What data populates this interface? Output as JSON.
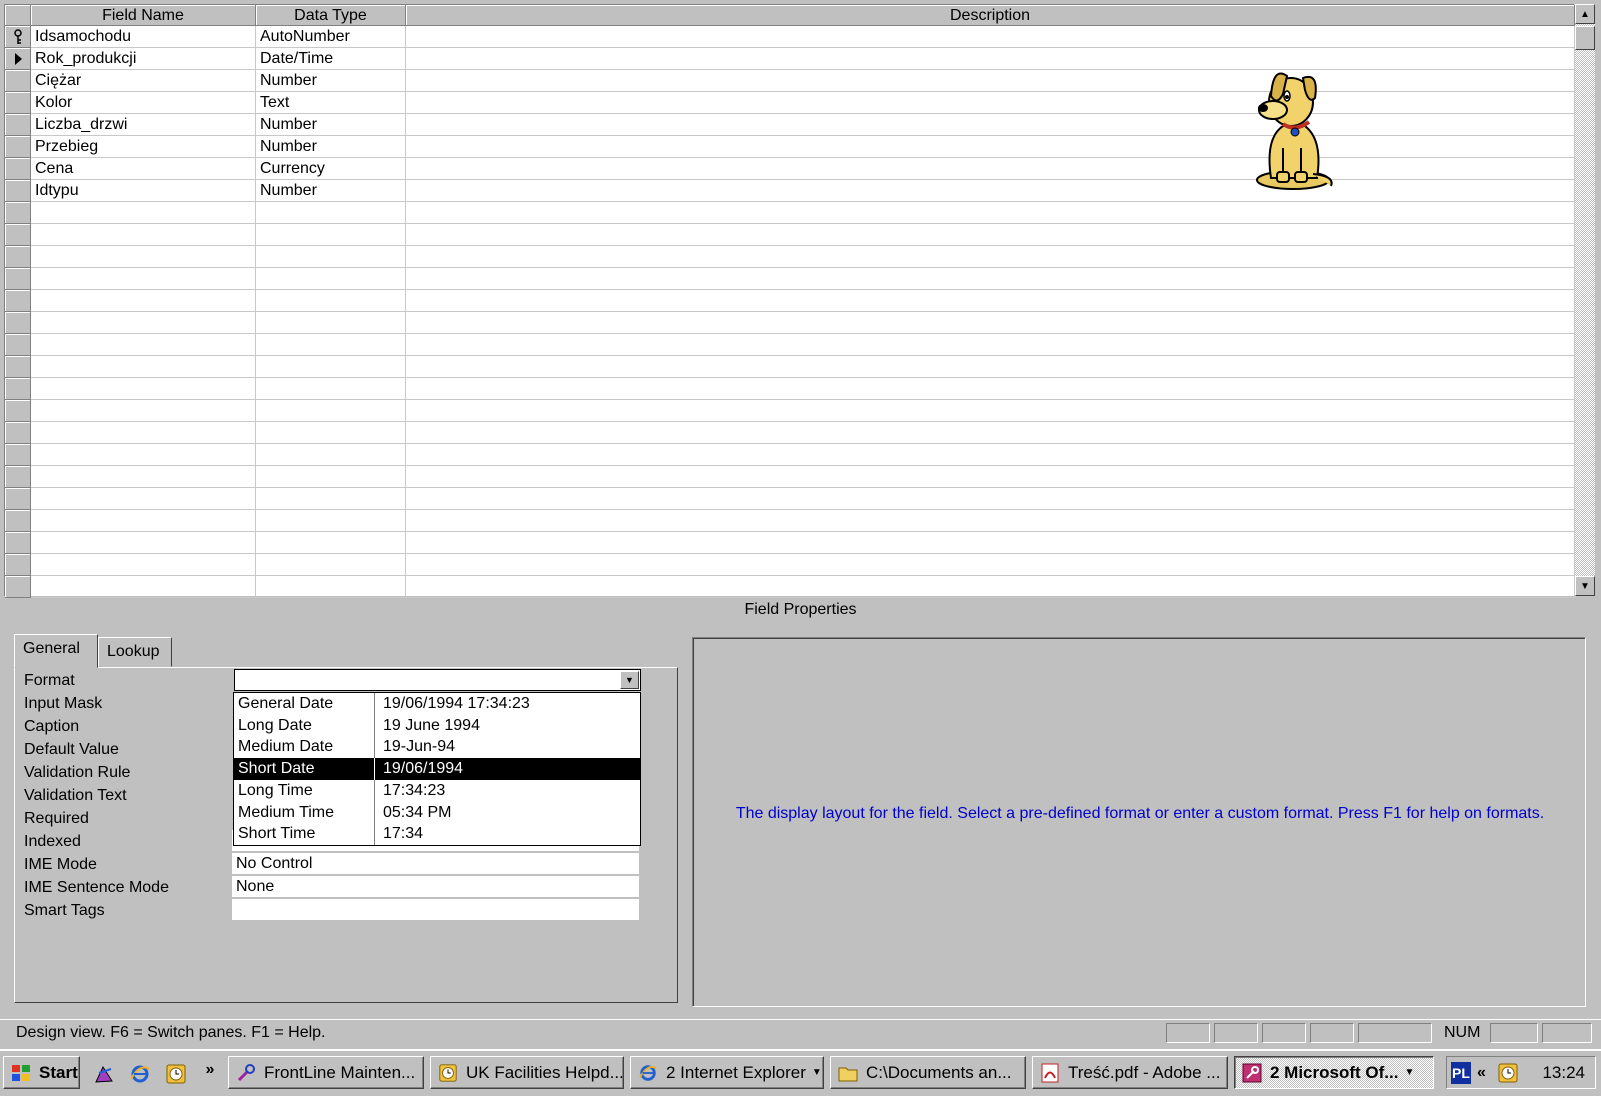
{
  "grid": {
    "headers": {
      "field_name": "Field Name",
      "data_type": "Data Type",
      "description": "Description"
    },
    "fields": [
      {
        "name": "Idsamochodu",
        "type": "AutoNumber",
        "indicator": "key"
      },
      {
        "name": "Rok_produkcji",
        "type": "Date/Time",
        "indicator": "current"
      },
      {
        "name": "Ciężar",
        "type": "Number",
        "indicator": ""
      },
      {
        "name": "Kolor",
        "type": "Text",
        "indicator": ""
      },
      {
        "name": "Liczba_drzwi",
        "type": "Number",
        "indicator": ""
      },
      {
        "name": "Przebieg",
        "type": "Number",
        "indicator": ""
      },
      {
        "name": "Cena",
        "type": "Currency",
        "indicator": ""
      },
      {
        "name": "Idtypu",
        "type": "Number",
        "indicator": ""
      }
    ],
    "empty_rows": 18
  },
  "field_properties": {
    "title": "Field Properties",
    "tabs": {
      "general": "General",
      "lookup": "Lookup"
    },
    "labels": {
      "format": "Format",
      "input_mask": "Input Mask",
      "caption": "Caption",
      "default_value": "Default Value",
      "validation_rule": "Validation Rule",
      "validation_text": "Validation Text",
      "required": "Required",
      "indexed": "Indexed",
      "ime_mode": "IME Mode",
      "ime_sentence_mode": "IME Sentence Mode",
      "smart_tags": "Smart Tags"
    },
    "values": {
      "format": "",
      "ime_mode": "No Control",
      "ime_sentence_mode": "None",
      "smart_tags": ""
    },
    "format_options": [
      {
        "name": "General Date",
        "example": "19/06/1994 17:34:23",
        "selected": false
      },
      {
        "name": "Long Date",
        "example": "19 June 1994",
        "selected": false
      },
      {
        "name": "Medium Date",
        "example": "19-Jun-94",
        "selected": false
      },
      {
        "name": "Short Date",
        "example": "19/06/1994",
        "selected": true
      },
      {
        "name": "Long Time",
        "example": "17:34:23",
        "selected": false
      },
      {
        "name": "Medium Time",
        "example": "05:34 PM",
        "selected": false
      },
      {
        "name": "Short Time",
        "example": "17:34",
        "selected": false
      }
    ],
    "help_text": "The display layout for the field.  Select a pre-defined format or enter a custom format.  Press F1 for help on formats."
  },
  "status_bar": {
    "text": "Design view.  F6 = Switch panes.  F1 = Help.",
    "num": "NUM"
  },
  "taskbar": {
    "start": "Start",
    "chevron": "»",
    "buttons": [
      {
        "label": "FrontLine Mainten...",
        "icon": "wrench-icon"
      },
      {
        "label": "UK Facilities Helpd...",
        "icon": "clock-icon"
      },
      {
        "label": "2 Internet Explorer",
        "icon": "ie-icon",
        "group": true
      },
      {
        "label": "C:\\Documents an...",
        "icon": "folder-icon"
      },
      {
        "label": "Treść.pdf - Adobe ...",
        "icon": "pdf-icon"
      },
      {
        "label": "2 Microsoft Of...",
        "icon": "access-key-icon",
        "group": true,
        "active": true
      }
    ],
    "tray": {
      "lang": "PL",
      "expand": "«",
      "clock": "13:24"
    }
  },
  "colors": {
    "chrome": "#c0c0c0",
    "help_text": "#0000cc",
    "selection": "#000000"
  }
}
